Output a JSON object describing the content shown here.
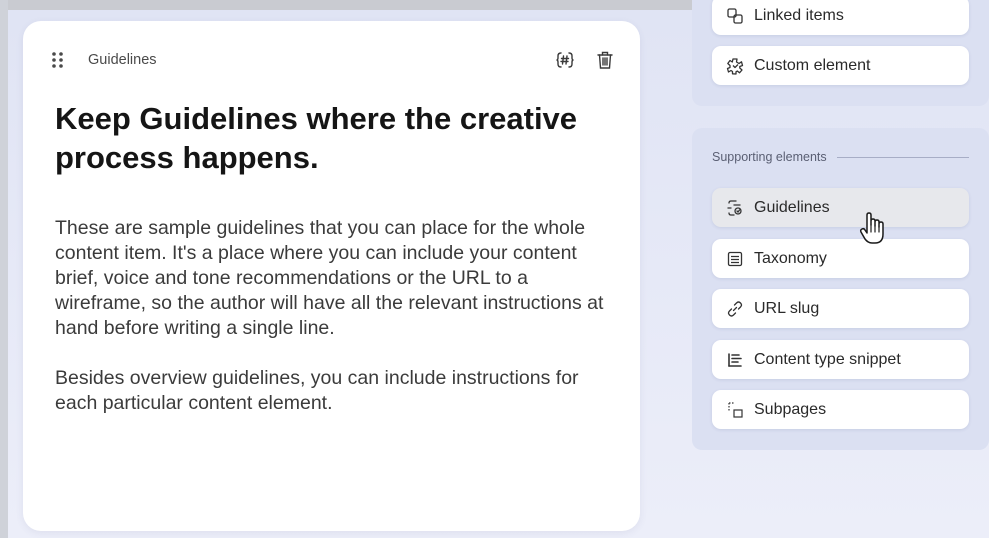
{
  "card": {
    "label": "Guidelines",
    "title": "Keep Guidelines where the creative process happens.",
    "paragraphs": [
      "These are sample guidelines that you can place for the whole content item. It's a place where you can include your content brief, voice and tone recommendations or the URL to a wireframe, so the author will have all the relevant instructions at hand before writing a single line.",
      "Besides overview guidelines, you can include instructions for each particular content element."
    ]
  },
  "sidebar": {
    "top_items": [
      {
        "label": "Linked items",
        "icon": "linked-items-icon"
      },
      {
        "label": "Custom element",
        "icon": "custom-element-icon"
      }
    ],
    "supporting_label": "Supporting elements",
    "supporting_items": [
      {
        "label": "Guidelines",
        "icon": "guidelines-icon",
        "active": true
      },
      {
        "label": "Taxonomy",
        "icon": "taxonomy-icon"
      },
      {
        "label": "URL slug",
        "icon": "link-icon"
      },
      {
        "label": "Content type snippet",
        "icon": "snippet-icon"
      },
      {
        "label": "Subpages",
        "icon": "subpages-icon"
      }
    ]
  },
  "colors": {
    "canvas": "#e3e6f4",
    "panel": "#dbe0f2",
    "card": "#ffffff",
    "active_item": "#e7e8ec"
  }
}
